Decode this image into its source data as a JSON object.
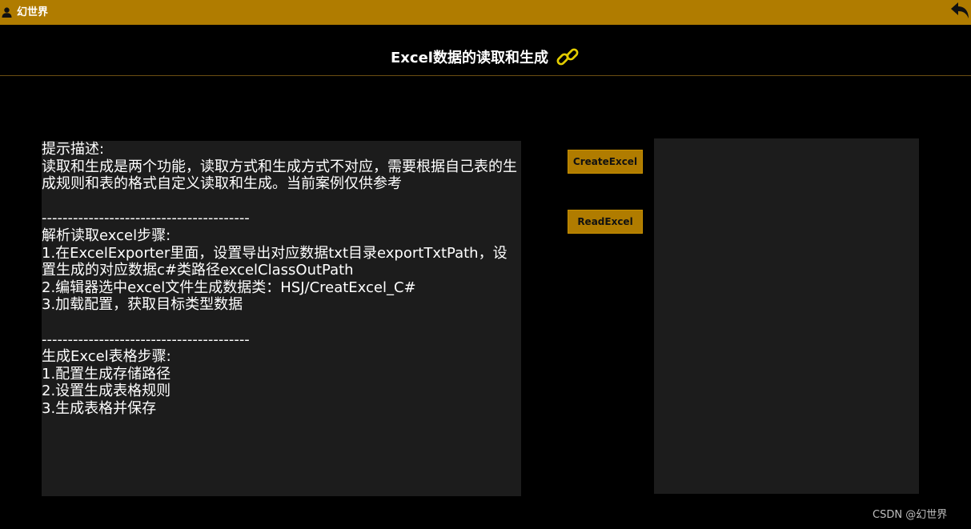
{
  "topbar": {
    "user_name": "幻世界",
    "user_icon": "user-icon",
    "back_icon": "back-arrow-icon",
    "bg_color": "#b07c00"
  },
  "header": {
    "title": "Excel数据的读取和生成",
    "title_icon": "link-icon"
  },
  "description": {
    "text": "提示描述:\n读取和生成是两个功能，读取方式和生成方式不对应，需要根据自己表的生成规则和表的格式自定义读取和生成。当前案例仅供参考\n\n----------------------------------------\n解析读取excel步骤:\n1.在ExcelExporter里面，设置导出对应数据txt目录exportTxtPath，设置生成的对应数据c#类路径excelClassOutPath\n2.编辑器选中excel文件生成数据类：HSJ/CreatExcel_C#\n3.加载配置，获取目标类型数据\n\n----------------------------------------\n生成Excel表格步骤:\n1.配置生成存储路径\n2.设置生成表格规则\n3.生成表格并保存"
  },
  "buttons": {
    "create_label": "CreateExcel",
    "read_label": "ReadExcel"
  },
  "watermark": "CSDN @幻世界"
}
